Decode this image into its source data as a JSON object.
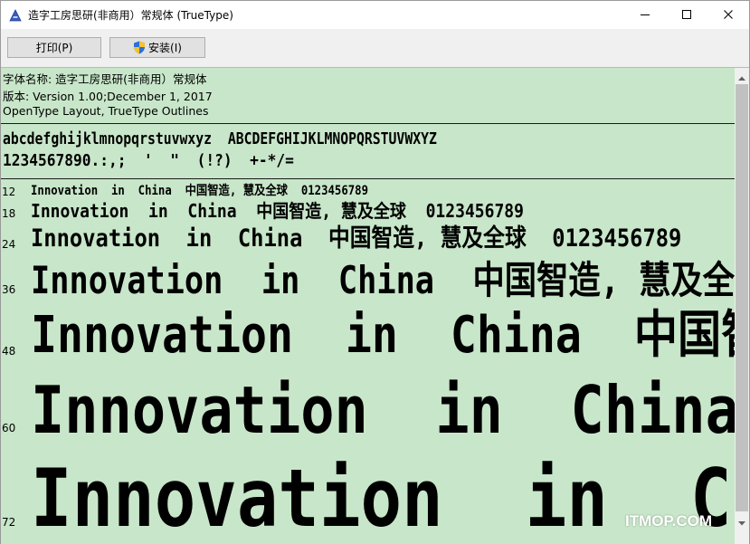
{
  "window": {
    "title": "造字工房思研(非商用）常规体 (TrueType)",
    "controls": {
      "minimize": "minimize-icon",
      "maximize": "maximize-icon",
      "close": "close-icon"
    }
  },
  "toolbar": {
    "print_label": "打印(P)",
    "install_label": "安装(I)"
  },
  "font_info": {
    "name_line": "字体名称: 造字工房思研(非商用）常规体",
    "version_line": "版本: Version 1.00;December 1, 2017",
    "type_line": "OpenType Layout, TrueType Outlines"
  },
  "charset": {
    "letters": "abcdefghijklmnopqrstuvwxyz  ABCDEFGHIJKLMNOPQRSTUVWXYZ",
    "digits": "1234567890.:,;  '  \"  (!?)  +-*/="
  },
  "samples": [
    {
      "size": "12",
      "text": "Innovation  in  China  中国智造, 慧及全球  0123456789"
    },
    {
      "size": "18",
      "text": "Innovation  in  China  中国智造, 慧及全球  0123456789"
    },
    {
      "size": "24",
      "text": "Innovation  in  China  中国智造, 慧及全球  0123456789"
    },
    {
      "size": "36",
      "text": "Innovation  in  China  中国智造, 慧及全球"
    },
    {
      "size": "48",
      "text": "Innovation  in  China  中国智造"
    },
    {
      "size": "60",
      "text": "Innovation  in  China  中"
    },
    {
      "size": "72",
      "text": "Innovation  in  China"
    }
  ],
  "watermark": "ITMOP.COM",
  "colors": {
    "preview_bg": "#c8e6c9",
    "toolbar_bg": "#f0f0f0"
  }
}
